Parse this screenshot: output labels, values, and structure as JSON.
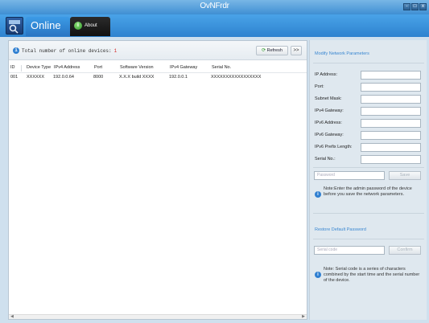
{
  "window": {
    "title": "OvNFrdr",
    "controls": [
      "-",
      "□",
      "x"
    ]
  },
  "header": {
    "tabs": [
      {
        "label": "Online"
      },
      {
        "label": "About"
      }
    ]
  },
  "toolbar": {
    "total_label": "Total number of online devices:",
    "total_count": "1",
    "refresh_label": "Refresh",
    "collapse_label": ">>"
  },
  "table": {
    "columns": [
      "ID",
      "Device Type",
      "IPv4 Address",
      "Port",
      "Software Version",
      "IPv4 Gateway",
      "Serial No."
    ],
    "rows": [
      [
        "001",
        "XXXXXX",
        "192.0.0.64",
        "8000",
        "X.X.X build XXXX",
        "192.0.0.1",
        "XXXXXXXXXXXXXXXXX"
      ]
    ]
  },
  "side": {
    "modify_title": "Modify Network Parameters",
    "fields": [
      "IP Address:",
      "Port:",
      "Subnet Mask:",
      "IPv4 Gateway:",
      "IPv6 Address:",
      "IPv6 Gateway:",
      "IPv6 Prefix Length:",
      "Serial No.:"
    ],
    "password_placeholder": "Password",
    "save_label": "Save",
    "save_note": "Note:Enter the admin password of the device before you save the network parameters.",
    "restore_title": "Restore Default Password",
    "serial_placeholder": "Serial code",
    "confirm_label": "Confirm",
    "serial_note": "Note: Serial code is a series of characters combined by the start time and the serial number of the device."
  }
}
